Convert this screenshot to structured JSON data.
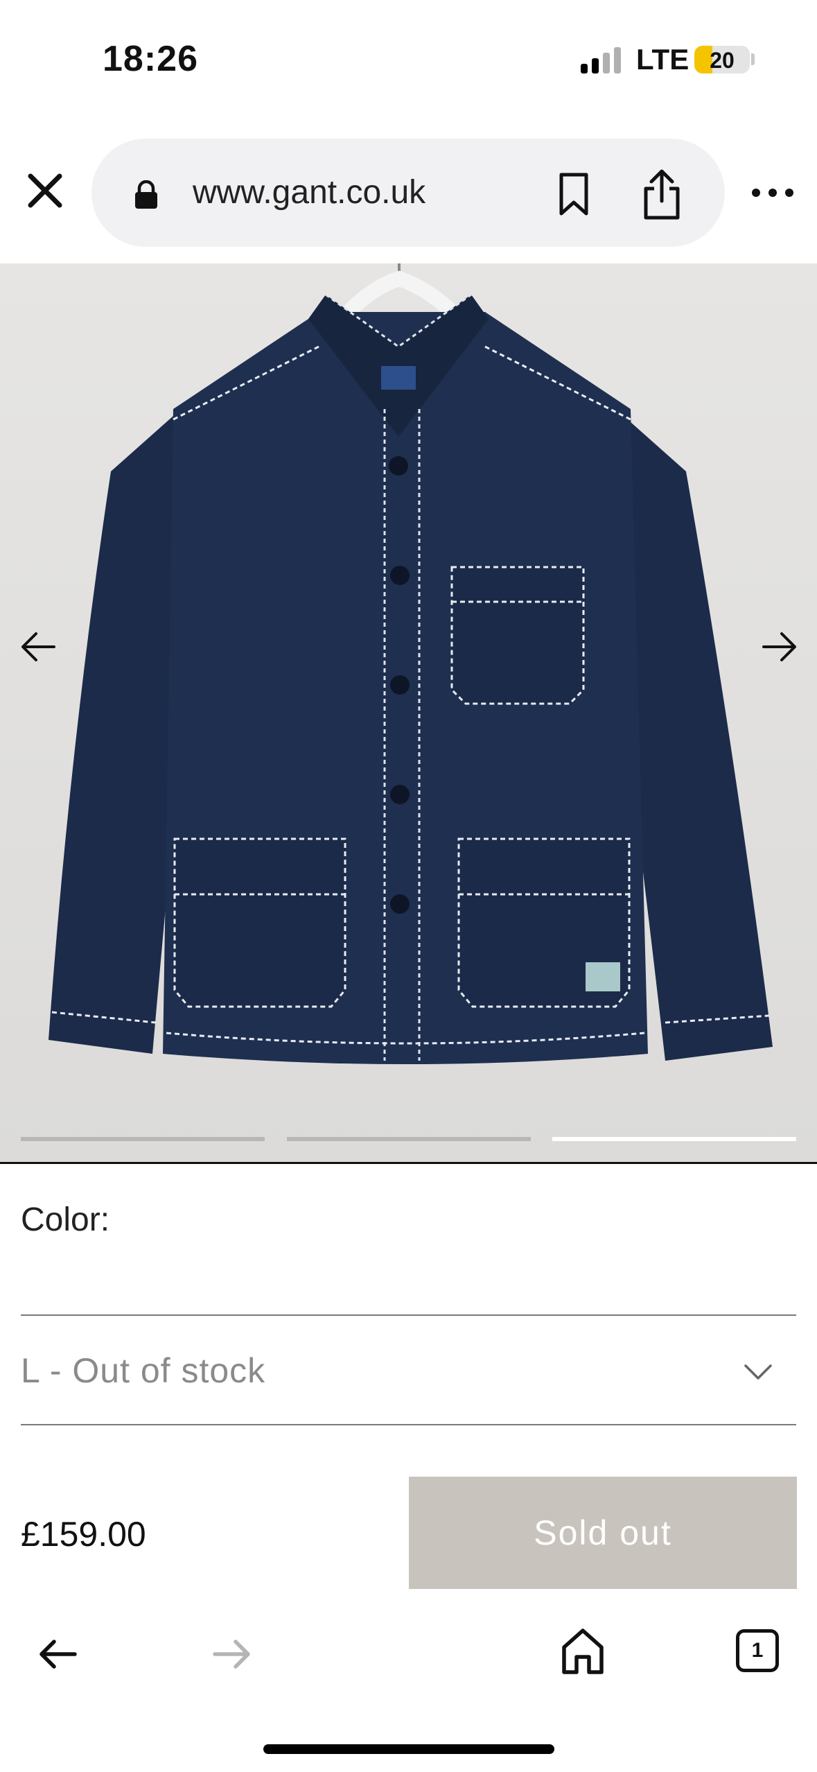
{
  "status_bar": {
    "time": "18:26",
    "network": "LTE",
    "battery_level": "20",
    "battery_color": "#f5c400"
  },
  "browser": {
    "url": "www.gant.co.uk",
    "icons": {
      "close": "close-icon",
      "lock": "lock-icon",
      "bookmark": "bookmark-icon",
      "share": "share-icon",
      "more": "more-icon"
    }
  },
  "gallery": {
    "image": "navy blue work jacket with white contrast stitching on a hanger",
    "slides_total": 3,
    "active_slide": 3,
    "icons": {
      "prev": "arrow-left-icon",
      "next": "arrow-right-icon"
    }
  },
  "product": {
    "color_label": "Color:",
    "size_selected": "L - Out of stock",
    "price": "£159.00",
    "button_label": "Sold out",
    "button_color": "#c9c3be"
  },
  "bottom_nav": {
    "tab_count": "1",
    "icons": {
      "back": "back-icon",
      "forward": "forward-icon",
      "home": "home-icon",
      "tabs": "tabs-icon"
    }
  }
}
